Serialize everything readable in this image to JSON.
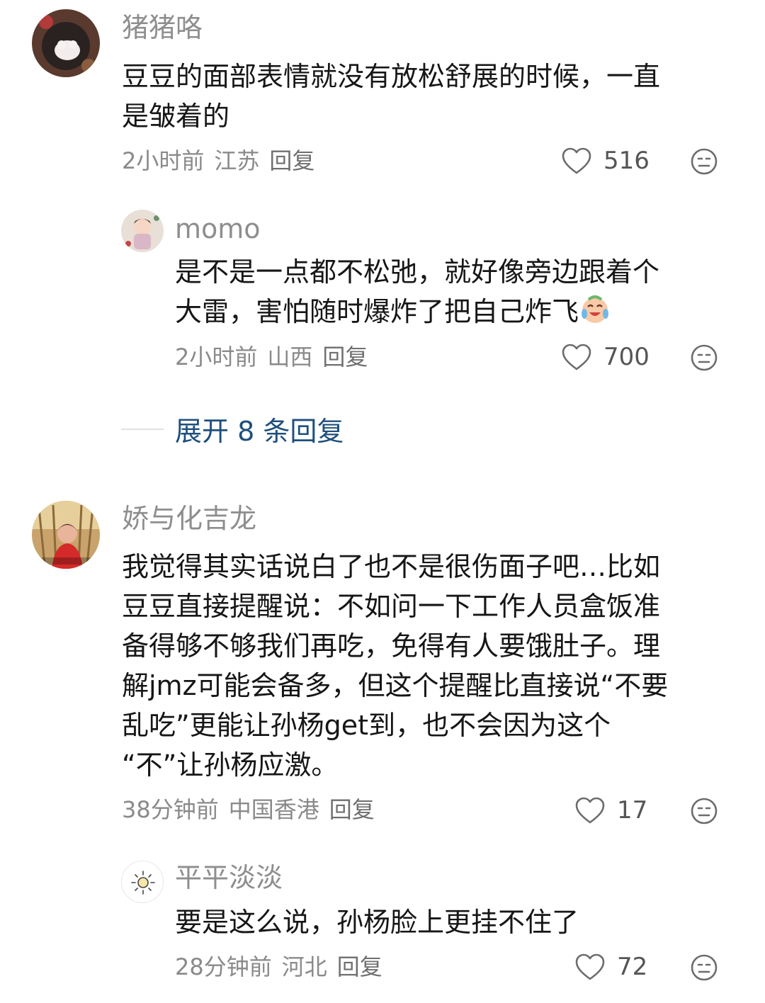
{
  "comments": [
    {
      "username": "猪猪咯",
      "text": "豆豆的面部表情就没有放松舒展的时候，一直\n是皱着的",
      "time": "2小时前",
      "location": "江苏",
      "reply_label": "回复",
      "likes": "516",
      "replies": [
        {
          "username": "momo",
          "text": "是不是一点都不松弛，就好像旁边跟着个\n大雷，害怕随时爆炸了把自己炸飞",
          "emoji": "laugh-cry-emoji",
          "time": "2小时前",
          "location": "山西",
          "reply_label": "回复",
          "likes": "700"
        }
      ],
      "expand_label": "展开 8 条回复"
    },
    {
      "username": "娇与化吉龙",
      "text": "我觉得其实话说白了也不是很伤面子吧…比如\n豆豆直接提醒说：不如问一下工作人员盒饭准\n备得够不够我们再吃，免得有人要饿肚子。理\n解jmz可能会备多，但这个提醒比直接说“不要\n乱吃”更能让孙杨get到，也不会因为这个\n“不”让孙杨应激。",
      "time": "38分钟前",
      "location": "中国香港",
      "reply_label": "回复",
      "likes": "17",
      "replies": [
        {
          "username": "平平淡淡",
          "text": "要是这么说，孙杨脸上更挂不住了",
          "time": "28分钟前",
          "location": "河北",
          "reply_label": "回复",
          "likes": "72"
        }
      ]
    }
  ],
  "colors": {
    "username": "#8e8e8e",
    "text": "#161616",
    "meta": "#8a8a8a",
    "expand": "#1f4f7d"
  }
}
